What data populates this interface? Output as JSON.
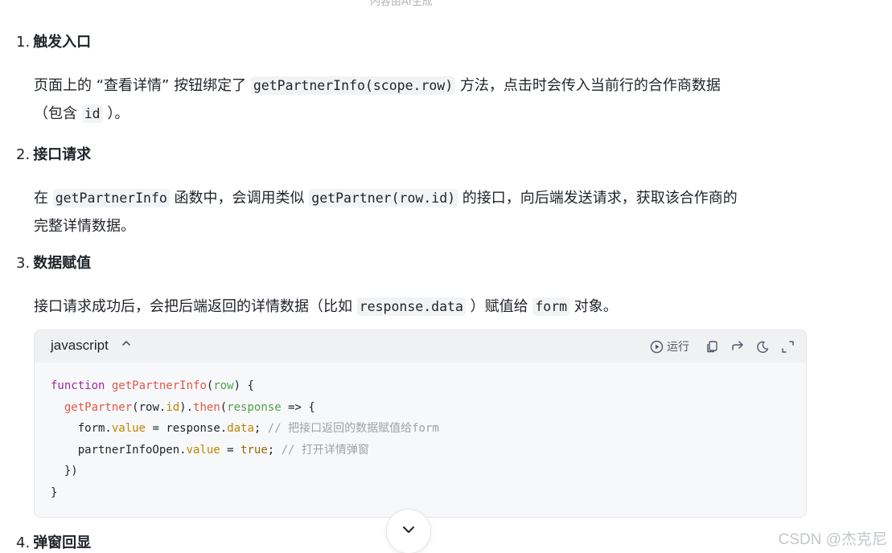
{
  "top_fragment": "内容由AI生成",
  "steps": [
    {
      "number": "1.",
      "title": "触发入口",
      "text_a": "页面上的 “查看详情” 按钮绑定了 ",
      "code_a": "getPartnerInfo(scope.row)",
      "text_b": " 方法，点击时会传入当前行的合作商数据",
      "text_c": "（包含 ",
      "code_b": "id",
      "text_d": " ）。"
    },
    {
      "number": "2.",
      "title": "接口请求",
      "text_a": "在 ",
      "code_a": "getPartnerInfo",
      "text_b": " 函数中，会调用类似 ",
      "code_b": "getPartner(row.id)",
      "text_c": " 的接口，向后端发送请求，获取该合作商的",
      "text_d": "完整详情数据。"
    },
    {
      "number": "3.",
      "title": "数据赋值",
      "text_a": "接口请求成功后，会把后端返回的详情数据（比如 ",
      "code_a": "response.data",
      "text_b": " ）赋值给 ",
      "code_b": "form",
      "text_c": " 对象。"
    },
    {
      "number": "4.",
      "title": "弹窗回显"
    }
  ],
  "code_block": {
    "language": "javascript",
    "run_label": "运行",
    "lines": {
      "l1_kw": "function",
      "l1_fn": "getPartnerInfo",
      "l1_p1": "(",
      "l1_arg": "row",
      "l1_p2": ") {",
      "l2_fn": "getPartner",
      "l2_a": "(row.",
      "l2_prop": "id",
      "l2_b": ").",
      "l2_then": "then",
      "l2_c": "(",
      "l2_arg": "response",
      "l2_d": " => {",
      "l3_a": "form.",
      "l3_prop": "value",
      "l3_b": " = response.",
      "l3_prop2": "data",
      "l3_c": ";",
      "l3_comment": "// 把接口返回的数据赋值给form",
      "l4_a": "partnerInfoOpen.",
      "l4_prop": "value",
      "l4_b": " = ",
      "l4_bool": "true",
      "l4_c": ";",
      "l4_comment": "// 打开详情弹窗",
      "l5": "})",
      "l6": "}"
    }
  },
  "watermark": "CSDN @杰克尼",
  "icons": {
    "caret": "chevron-up-icon",
    "run": "play-circle-icon",
    "copy": "copy-icon",
    "share": "share-arrow-icon",
    "theme": "moon-icon",
    "expand": "expand-icon",
    "scroll": "chevron-down-icon"
  }
}
